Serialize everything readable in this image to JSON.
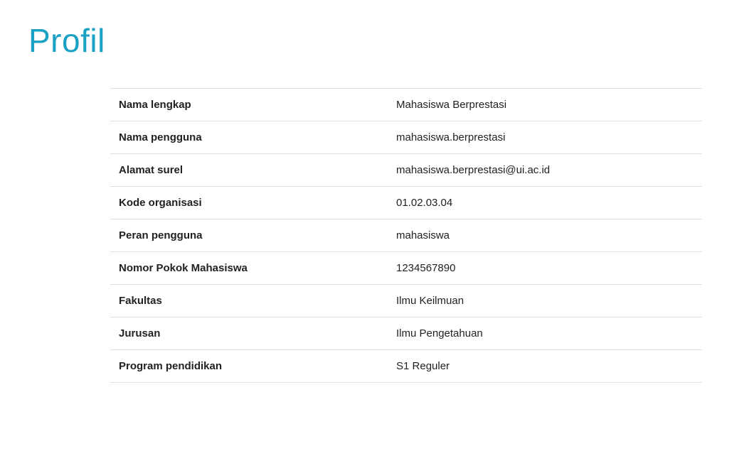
{
  "page": {
    "title": "Profil"
  },
  "profile": {
    "rows": [
      {
        "label": "Nama lengkap",
        "value": "Mahasiswa Berprestasi"
      },
      {
        "label": "Nama pengguna",
        "value": "mahasiswa.berprestasi"
      },
      {
        "label": "Alamat surel",
        "value": "mahasiswa.berprestasi@ui.ac.id"
      },
      {
        "label": "Kode organisasi",
        "value": "01.02.03.04"
      },
      {
        "label": "Peran pengguna",
        "value": "mahasiswa"
      },
      {
        "label": "Nomor Pokok Mahasiswa",
        "value": "1234567890"
      },
      {
        "label": "Fakultas",
        "value": "Ilmu Keilmuan"
      },
      {
        "label": "Jurusan",
        "value": "Ilmu Pengetahuan"
      },
      {
        "label": "Program pendidikan",
        "value": "S1 Reguler"
      }
    ]
  }
}
